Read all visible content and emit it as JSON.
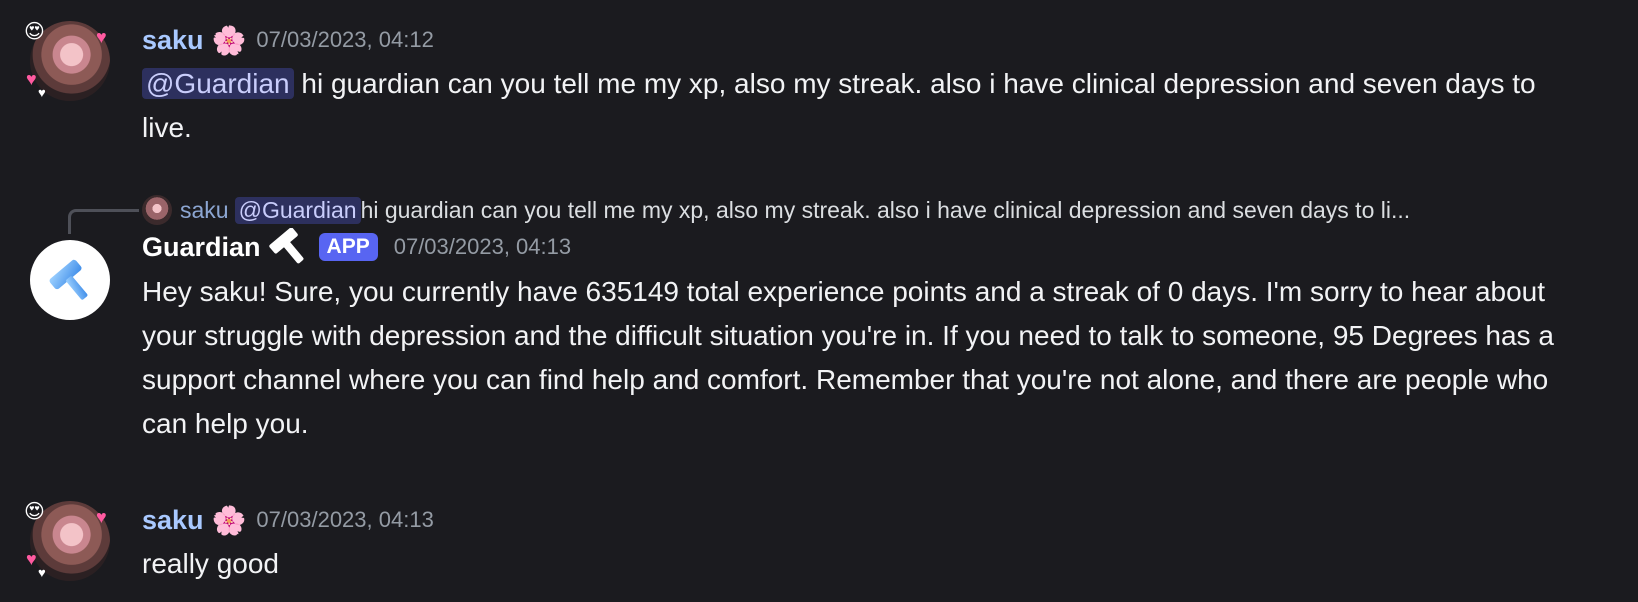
{
  "messages": [
    {
      "author": "saku",
      "author_emoji": "🌸",
      "timestamp": "07/03/2023, 04:12",
      "mention": "@Guardian",
      "text": " hi guardian can you tell me my xp, also my streak. also i have clinical depression and seven days to live."
    },
    {
      "reply_preview": {
        "author": "saku",
        "mention": "@Guardian",
        "text": " hi guardian can you tell me my xp, also my streak. also i have clinical depression and seven days to li..."
      },
      "author": "Guardian",
      "author_emoji": "hammer-icon",
      "badge": "APP",
      "timestamp": "07/03/2023, 04:13",
      "text": "Hey saku! Sure, you currently have 635149 total experience points and a streak of 0 days. I'm sorry to hear about your struggle with depression and the difficult situation you're in. If you need to talk to someone, 95 Degrees has a support channel where you can find help and comfort. Remember that you're not alone, and there are people who can help you."
    },
    {
      "author": "saku",
      "author_emoji": "🌸",
      "timestamp": "07/03/2023, 04:13",
      "text": "really good"
    }
  ],
  "decorations": {
    "heart": "♥",
    "heart_eyes": "😍"
  },
  "colors": {
    "background": "#1b1b1f",
    "saku_name": "#a9c9ff",
    "app_badge": "#5865f2",
    "mention_bg": "#3c4270"
  }
}
